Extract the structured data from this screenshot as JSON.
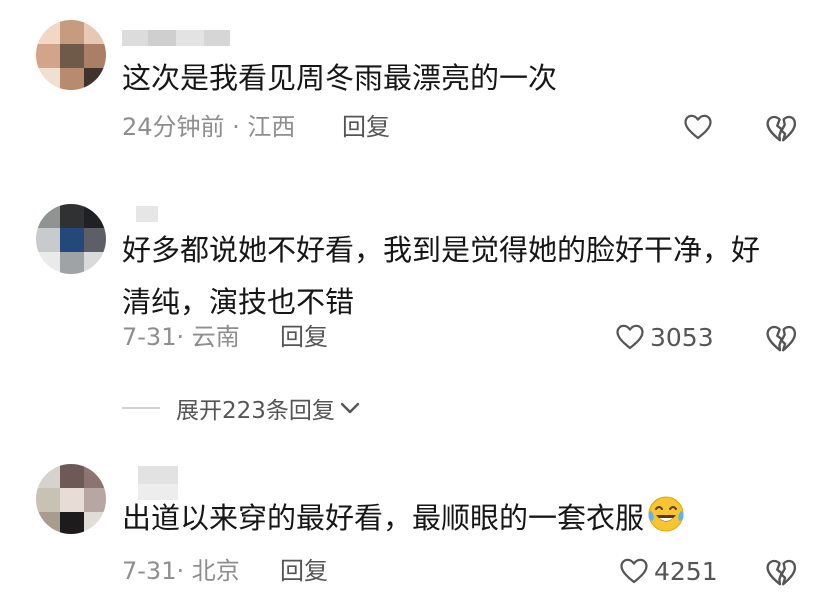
{
  "comments": [
    {
      "text": "这次是我看见周冬雨最漂亮的一次",
      "time_location": "24分钟前 · 江西",
      "reply_label": "回复",
      "like_count": "",
      "like_icon": "heart-outline-icon",
      "dislike_icon": "broken-heart-icon"
    },
    {
      "text": "好多都说她不好看，我到是觉得她的脸好干净，好\n清纯，演技也不错",
      "time_location": "7-31· 云南",
      "reply_label": "回复",
      "like_count": "3053",
      "like_icon": "heart-outline-icon",
      "dislike_icon": "broken-heart-icon"
    },
    {
      "text": "出道以来穿的最好看，最顺眼的一套衣服",
      "emoji": "laughing-crying-emoji",
      "time_location": "7-31· 北京",
      "reply_label": "回复",
      "like_count": "4251",
      "like_icon": "heart-outline-icon",
      "dislike_icon": "broken-heart-icon"
    }
  ],
  "expand_replies": {
    "label": "展开223条回复",
    "icon": "chevron-down-icon"
  },
  "colors": {
    "text": "#161616",
    "meta": "#8e8e8e",
    "action": "#555555",
    "emoji": "#f7c531"
  }
}
